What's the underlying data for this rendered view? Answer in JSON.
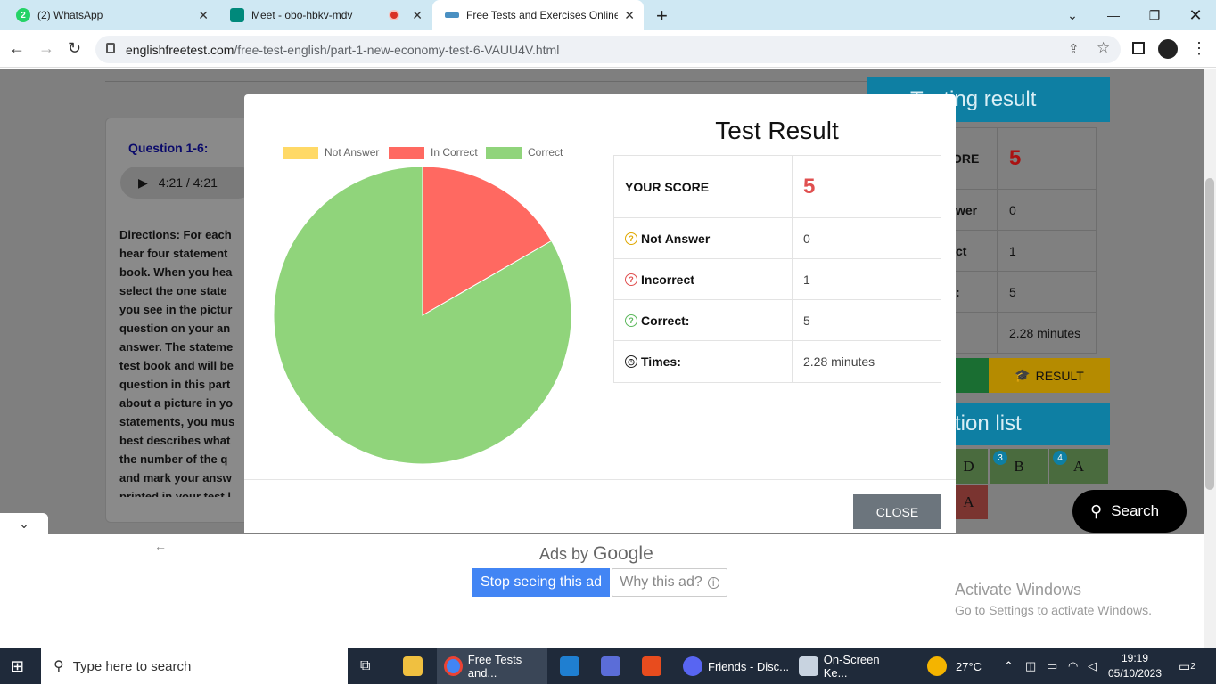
{
  "browser": {
    "tabs": [
      {
        "label": "(2) WhatsApp",
        "icon": "whatsapp-icon",
        "badge": "2"
      },
      {
        "label": "Meet - obo-hbkv-mdv",
        "icon": "meet-icon"
      },
      {
        "label": "Free Tests and Exercises Online f",
        "icon": "site-icon",
        "active": true
      }
    ],
    "url_domain": "englishfreetest.com",
    "url_path": "/free-test-english/part-1-new-economy-test-6-VAUU4V.html"
  },
  "page": {
    "question_title": "Question 1-6:",
    "audio_time": "4:21 / 4:21",
    "directions": "Directions: For each\nhear four statement\nbook. When you hea\nselect the one state\nyou see in the pictur\nquestion on your an\nanswer. The stateme\ntest book and will be\nquestion in this part\nabout a picture in yo\nstatements, you mus\nbest describes what\nthe number of the q\nand mark your answ\nprinted in your test l",
    "testing_result_header": "Testing result",
    "side_rows": [
      {
        "label": "ORE",
        "value": "5"
      },
      {
        "label": "wer",
        "value": "0"
      },
      {
        "label": "ct",
        "value": "1"
      },
      {
        "label": ":",
        "value": "5"
      },
      {
        "label": "",
        "value": "2.28 minutes"
      }
    ],
    "result_button": "RESULT",
    "question_list_header": "tion list",
    "question_cells": [
      {
        "num": "",
        "answer": "D"
      },
      {
        "num": "3",
        "answer": "B"
      },
      {
        "num": "4",
        "answer": "A"
      },
      {
        "num": "",
        "answer": "A"
      }
    ]
  },
  "modal": {
    "title": "Test Result",
    "legend": [
      {
        "label": "Not Answer",
        "color": "#ffd966"
      },
      {
        "label": "In Correct",
        "color": "#ff6961"
      },
      {
        "label": "Correct",
        "color": "#90d47b"
      }
    ],
    "rows": [
      {
        "label": "YOUR SCORE",
        "value": "5"
      },
      {
        "label": "Not Answer",
        "value": "0",
        "icon": "question-icon"
      },
      {
        "label": "Incorrect",
        "value": "1",
        "icon": "question-icon"
      },
      {
        "label": "Correct:",
        "value": "5",
        "icon": "question-icon"
      },
      {
        "label": "Times:",
        "value": "2.28 minutes",
        "icon": "clock-icon"
      }
    ],
    "close_label": "CLOSE"
  },
  "chart_data": {
    "type": "pie",
    "categories": [
      "Not Answer",
      "In Correct",
      "Correct"
    ],
    "values": [
      0,
      1,
      5
    ],
    "colors": [
      "#ffd966",
      "#ff6961",
      "#90d47b"
    ],
    "legend_position": "top"
  },
  "ads": {
    "ads_by": "Ads by",
    "google": "Google",
    "stop_label": "Stop seeing this ad",
    "why_label": "Why this ad?"
  },
  "windows_watermark": {
    "line1": "Activate Windows",
    "line2": "Go to Settings to activate Windows."
  },
  "search_fab": "Search",
  "taskbar": {
    "search_placeholder": "Type here to search",
    "apps": [
      {
        "label": "Free Tests and...",
        "icon": "chrome-icon"
      },
      {
        "label": "Friends - Disc...",
        "icon": "discord-icon"
      },
      {
        "label": "On-Screen Ke...",
        "icon": "keyboard-icon"
      }
    ],
    "weather": "27°C",
    "time": "19:19",
    "date": "05/10/2023",
    "notification_count": "2"
  }
}
